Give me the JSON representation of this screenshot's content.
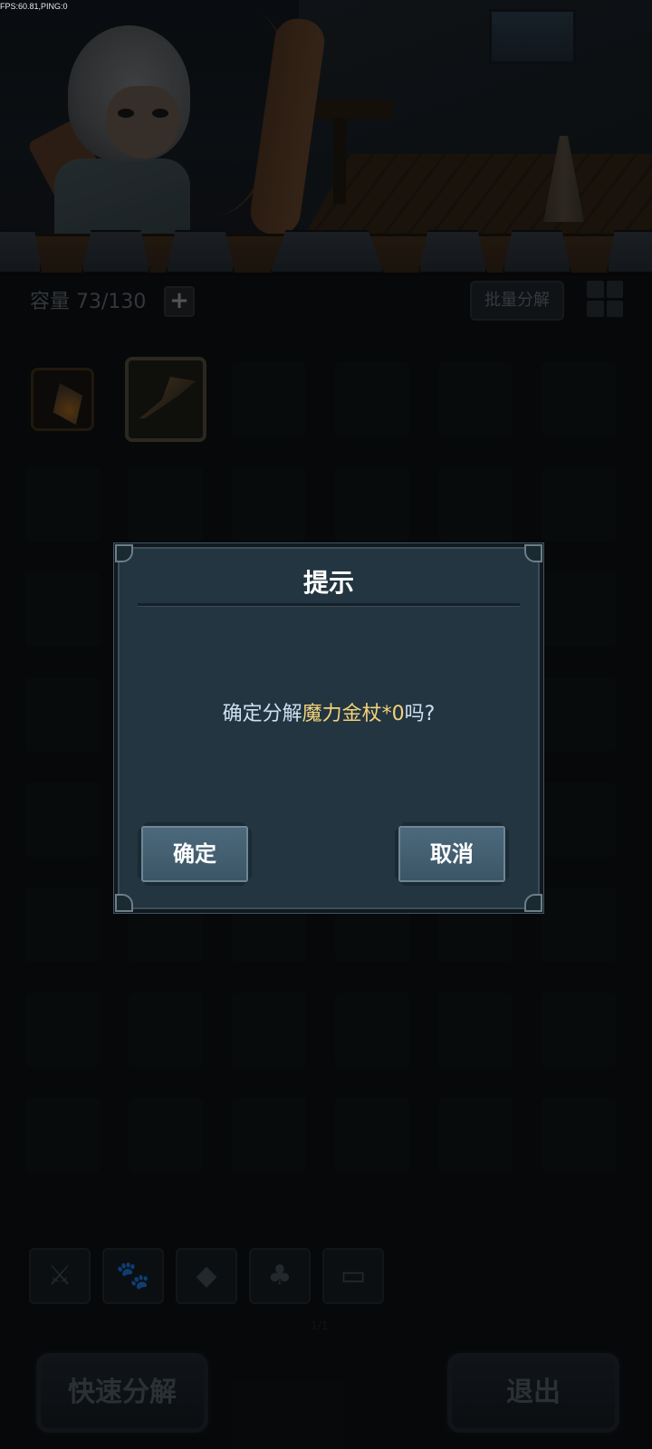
{
  "debug": {
    "fps_text": "FPS:60.81,PING:0"
  },
  "inventory": {
    "capacity_label": "容量 73/130",
    "add_icon": "plus-icon",
    "bulk_decompose_label": "批量分解",
    "view_toggle_icon": "grid-view-icon",
    "items": [
      {
        "name": "fire-gem-item",
        "icon": "gem-icon"
      },
      {
        "name": "staff-item",
        "icon": "staff-icon"
      }
    ]
  },
  "category_tabs": [
    {
      "name": "weapon-tab",
      "icon": "sword-axe-icon",
      "glyph": "⚔"
    },
    {
      "name": "pet-tab",
      "icon": "paw-icon",
      "glyph": "🐾"
    },
    {
      "name": "gem-tab",
      "icon": "diamond-icon",
      "glyph": "◆"
    },
    {
      "name": "material-tab",
      "icon": "leaf-icon",
      "glyph": "♣"
    },
    {
      "name": "chest-tab",
      "icon": "chest-icon",
      "glyph": "▭"
    }
  ],
  "page_indicator": "1/1",
  "bottom": {
    "quick_decompose_label": "快速分解",
    "exit_label": "退出"
  },
  "dialog": {
    "title": "提示",
    "message_prefix": "确定分解",
    "message_item": "魔力金杖*0",
    "message_suffix": "吗?",
    "confirm_label": "确定",
    "cancel_label": "取消",
    "colors": {
      "panel": "#233540",
      "highlight": "#f2d27a",
      "text": "#cfe0f0"
    }
  }
}
